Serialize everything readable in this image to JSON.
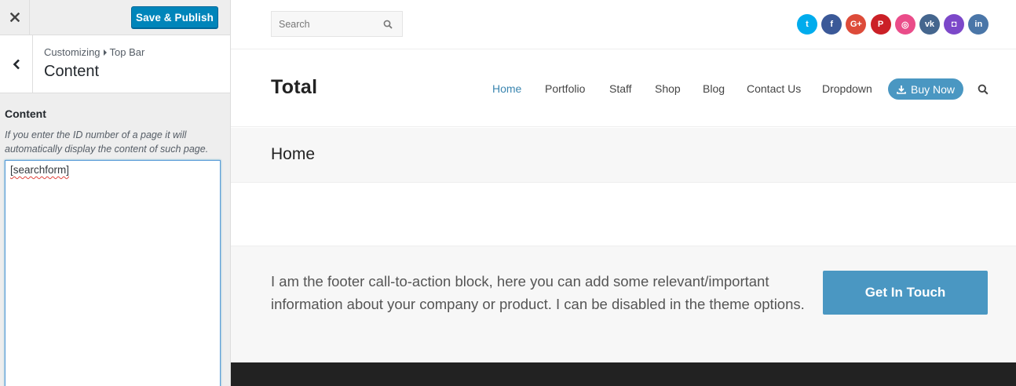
{
  "customizer": {
    "close_icon": "close-icon",
    "publish_label": "Save & Publish",
    "back_icon": "chevron-left-icon",
    "breadcrumb": {
      "parent": "Customizing",
      "current": "Top Bar"
    },
    "section_title": "Content",
    "control": {
      "label": "Content",
      "description": "If you enter the ID number of a page it will automatically display the content of such page.",
      "value": "[searchform]"
    },
    "colors": {
      "publish": "#0085ba",
      "panel_bg": "#eeeeee"
    }
  },
  "preview": {
    "topbar": {
      "search_placeholder": "Search",
      "social": [
        {
          "name": "twitter",
          "glyph": "t",
          "color": "#00aced"
        },
        {
          "name": "facebook",
          "glyph": "f",
          "color": "#3b5998"
        },
        {
          "name": "google-plus",
          "glyph": "G+",
          "color": "#dd4b39"
        },
        {
          "name": "pinterest",
          "glyph": "P",
          "color": "#cb2027"
        },
        {
          "name": "dribbble",
          "glyph": "◎",
          "color": "#ea4c89"
        },
        {
          "name": "vk",
          "glyph": "vk",
          "color": "#45668e"
        },
        {
          "name": "instagram",
          "glyph": "◘",
          "color": "#7c48c9"
        },
        {
          "name": "linkedin",
          "glyph": "in",
          "color": "#4a76a8"
        }
      ]
    },
    "header": {
      "logo": "Total",
      "nav": [
        "Home",
        "Portfolio",
        "Staff",
        "Shop",
        "Blog",
        "Contact Us",
        "Dropdown"
      ],
      "active_nav": "Home",
      "buy_label": "Buy Now",
      "accent": "#4a97c2"
    },
    "page_title": "Home",
    "cta": {
      "text": "I am the footer call-to-action block, here you can add some relevant/important information about your company or product. I can be disabled in the theme options.",
      "button_label": "Get In Touch"
    },
    "colors": {
      "footer_bg": "#222222"
    }
  }
}
